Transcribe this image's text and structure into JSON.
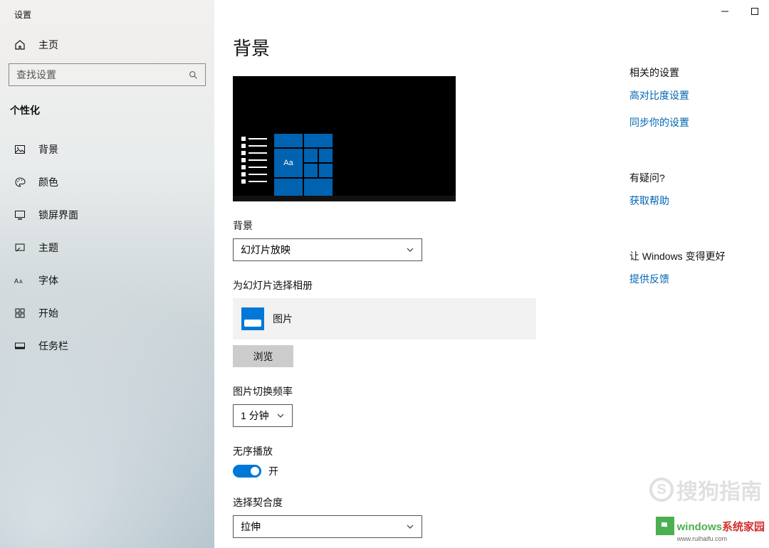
{
  "window": {
    "title": "设置"
  },
  "sidebar": {
    "home_label": "主页",
    "search_placeholder": "查找设置",
    "section_title": "个性化",
    "items": [
      {
        "label": "背景"
      },
      {
        "label": "颜色"
      },
      {
        "label": "锁屏界面"
      },
      {
        "label": "主题"
      },
      {
        "label": "字体"
      },
      {
        "label": "开始"
      },
      {
        "label": "任务栏"
      }
    ]
  },
  "main": {
    "title": "背景",
    "preview_tile_text": "Aa",
    "background_label": "背景",
    "background_value": "幻灯片放映",
    "album_label": "为幻灯片选择相册",
    "album_value": "图片",
    "browse_label": "浏览",
    "interval_label": "图片切换频率",
    "interval_value": "1 分钟",
    "shuffle_label": "无序播放",
    "shuffle_state": "开",
    "fit_label": "选择契合度",
    "fit_value": "拉伸"
  },
  "right": {
    "related_title": "相关的设置",
    "high_contrast": "高对比度设置",
    "sync": "同步你的设置",
    "question_title": "有疑问?",
    "get_help": "获取帮助",
    "feedback_title": "让 Windows 变得更好",
    "feedback_link": "提供反馈"
  },
  "watermarks": {
    "sogou": "搜狗指南",
    "win_text": "windows",
    "win_suffix": "系统家园",
    "win_sub": "www.ruihaifu.com"
  }
}
